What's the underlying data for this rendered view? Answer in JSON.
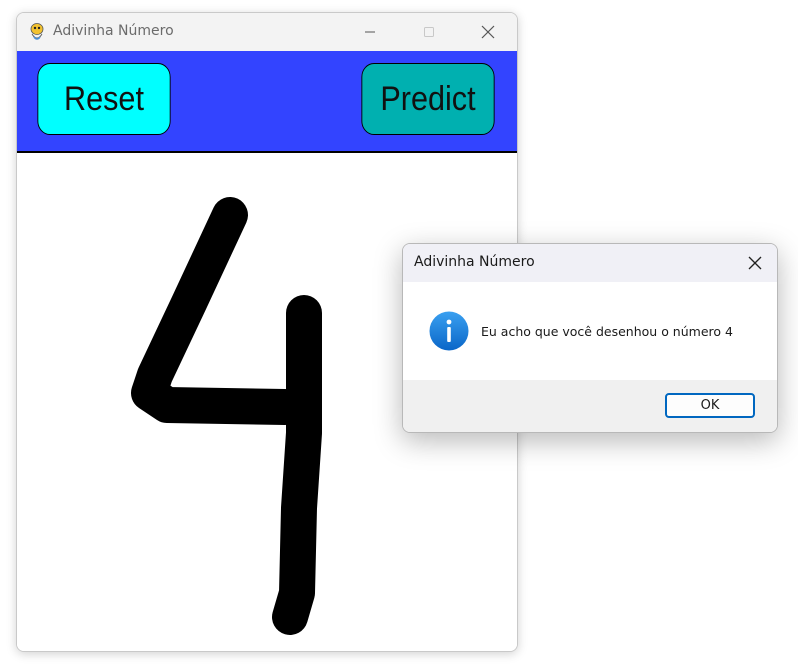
{
  "main_window": {
    "title": "Adivinha Número",
    "icon": "pygame-snake-icon",
    "controls": {
      "minimize": "minimize-icon",
      "maximize": "maximize-icon",
      "close": "close-icon"
    }
  },
  "toolbar": {
    "background": "#3344ff",
    "reset_label": "Reset",
    "reset_color": "#00ffff",
    "predict_label": "Predict",
    "predict_color": "#00b0b0"
  },
  "canvas": {
    "drawn_content": "handwritten-digit-stroke",
    "stroke_color": "#000000"
  },
  "dialog": {
    "title": "Adivinha Número",
    "icon": "info-icon",
    "message": "Eu acho que você desenhou o número 4",
    "ok_label": "OK",
    "accent": "#0067c0"
  }
}
